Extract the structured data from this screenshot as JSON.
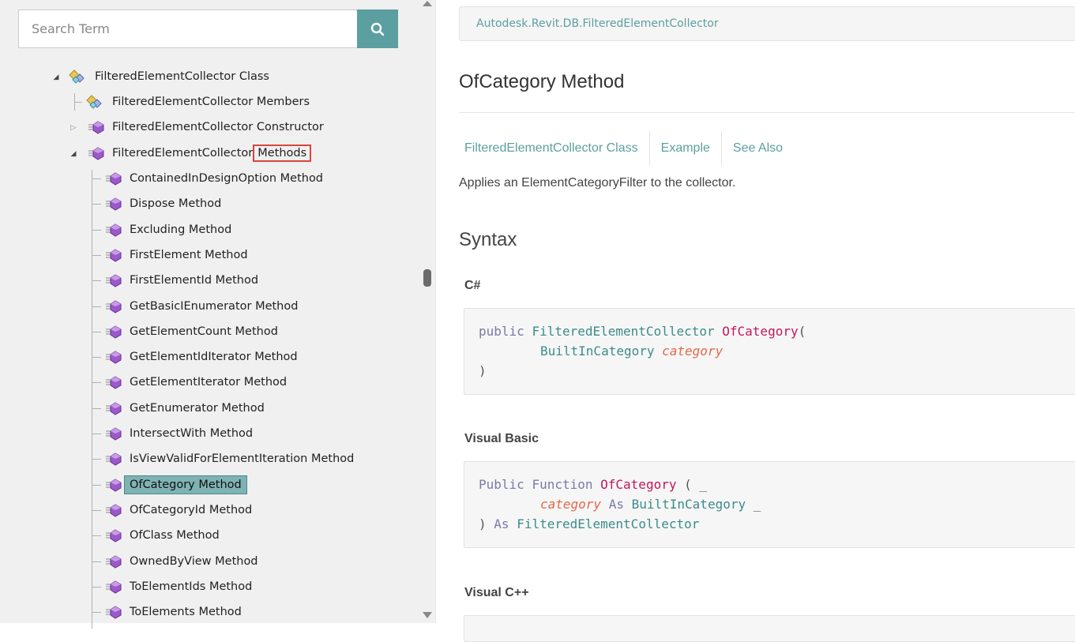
{
  "search": {
    "placeholder": "Search Term"
  },
  "tree": {
    "class_node": "FilteredElementCollector Class",
    "members_node": "FilteredElementCollector Members",
    "constructor_node": "FilteredElementCollector Constructor",
    "methods_node_prefix": "FilteredElementCollector",
    "methods_node_highlight": "Methods",
    "methods": [
      "ContainedInDesignOption Method",
      "Dispose Method",
      "Excluding Method",
      "FirstElement Method",
      "FirstElementId Method",
      "GetBasicIEnumerator Method",
      "GetElementCount Method",
      "GetElementIdIterator Method",
      "GetElementIterator Method",
      "GetEnumerator Method",
      "IntersectWith Method",
      "IsViewValidForElementIteration Method",
      "OfCategory Method",
      "OfCategoryId Method",
      "OfClass Method",
      "OwnedByView Method",
      "ToElementIds Method",
      "ToElements Method"
    ],
    "selected_method": "OfCategory Method"
  },
  "content": {
    "breadcrumb": "Autodesk.Revit.DB.FilteredElementCollector",
    "title": "OfCategory Method",
    "section_links": [
      "FilteredElementCollector Class",
      "Example",
      "See Also"
    ],
    "summary": "Applies an ElementCategoryFilter to the collector.",
    "syntax_heading": "Syntax",
    "csharp": {
      "heading": "C#",
      "kw_public": "public",
      "return_type": "FilteredElementCollector",
      "method": "OfCategory",
      "open_paren": "(",
      "param_type": "BuiltInCategory",
      "param_name": "category",
      "close_paren": ")"
    },
    "vb": {
      "heading": "Visual Basic",
      "kw_public": "Public",
      "kw_function": "Function",
      "method": "OfCategory",
      "open": "( _",
      "param_name": "category",
      "kw_as": "As",
      "param_type": "BuiltInCategory",
      "cont": "_",
      "close": ")",
      "kw_as2": "As",
      "return_type": "FilteredElementCollector"
    },
    "cpp": {
      "heading": "Visual C++"
    }
  }
}
